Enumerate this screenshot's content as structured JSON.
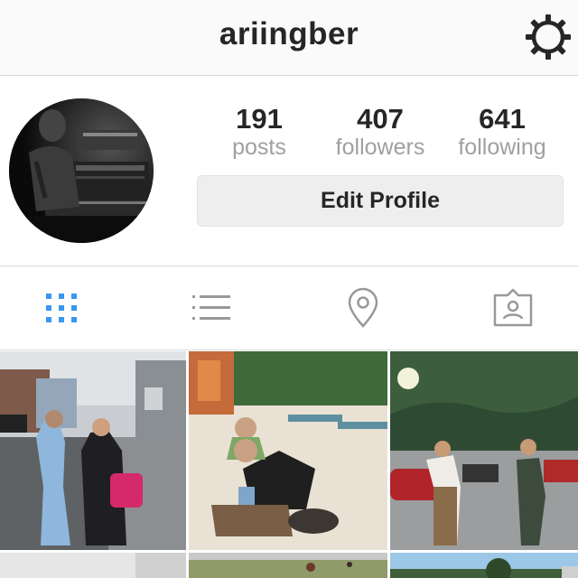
{
  "header": {
    "username": "ariingber",
    "settings_icon": "gear-icon"
  },
  "profile": {
    "avatar_icon": "profile-photo",
    "stats": [
      {
        "value": "191",
        "label": "posts"
      },
      {
        "value": "407",
        "label": "followers"
      },
      {
        "value": "641",
        "label": "following"
      }
    ],
    "edit_label": "Edit Profile"
  },
  "tabs": [
    {
      "icon": "grid-icon",
      "active": true
    },
    {
      "icon": "list-icon",
      "active": false
    },
    {
      "icon": "location-pin-icon",
      "active": false
    },
    {
      "icon": "tagged-photos-icon",
      "active": false
    }
  ],
  "colors": {
    "accent": "#3897f0",
    "icon_gray": "#999999",
    "text": "#262626",
    "muted": "#a0a0a0",
    "button_bg": "#eeeeee"
  }
}
